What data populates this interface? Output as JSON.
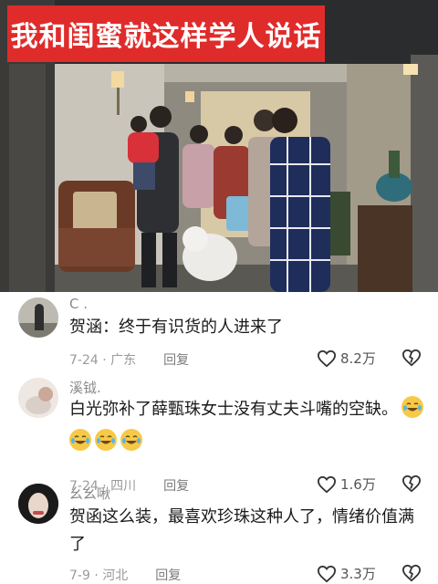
{
  "video": {
    "title_banner": "我和闺蜜就这样学人说话",
    "colors": {
      "banner": "#e02b2b",
      "banner_text": "#ffffff"
    }
  },
  "comments": [
    {
      "username": "C .",
      "text": "贺涵：终于有识货的人进来了",
      "date": "7-24 · 广东",
      "reply_label": "回复",
      "likes": "8.2万",
      "like_icon": "heart-outline-icon",
      "dislike_icon": "broken-heart-icon"
    },
    {
      "username": "溪钺.",
      "text": "白光弥补了薛甄珠女士没有丈夫斗嘴的空缺。",
      "emojis": [
        "crying-laughing-emoji",
        "crying-laughing-emoji",
        "crying-laughing-emoji",
        "crying-laughing-emoji"
      ],
      "date": "7-24 · 四川",
      "reply_label": "回复",
      "likes": "1.6万",
      "like_icon": "heart-outline-icon",
      "dislike_icon": "broken-heart-icon"
    },
    {
      "username": "幺幺啾",
      "text_line1": "贺函这么装，最喜欢珍珠这种人了，情绪价值满",
      "text_line2": "了",
      "date": "7-9 · 河北",
      "reply_label": "回复",
      "likes": "3.3万",
      "like_icon": "heart-outline-icon",
      "dislike_icon": "broken-heart-icon"
    }
  ]
}
